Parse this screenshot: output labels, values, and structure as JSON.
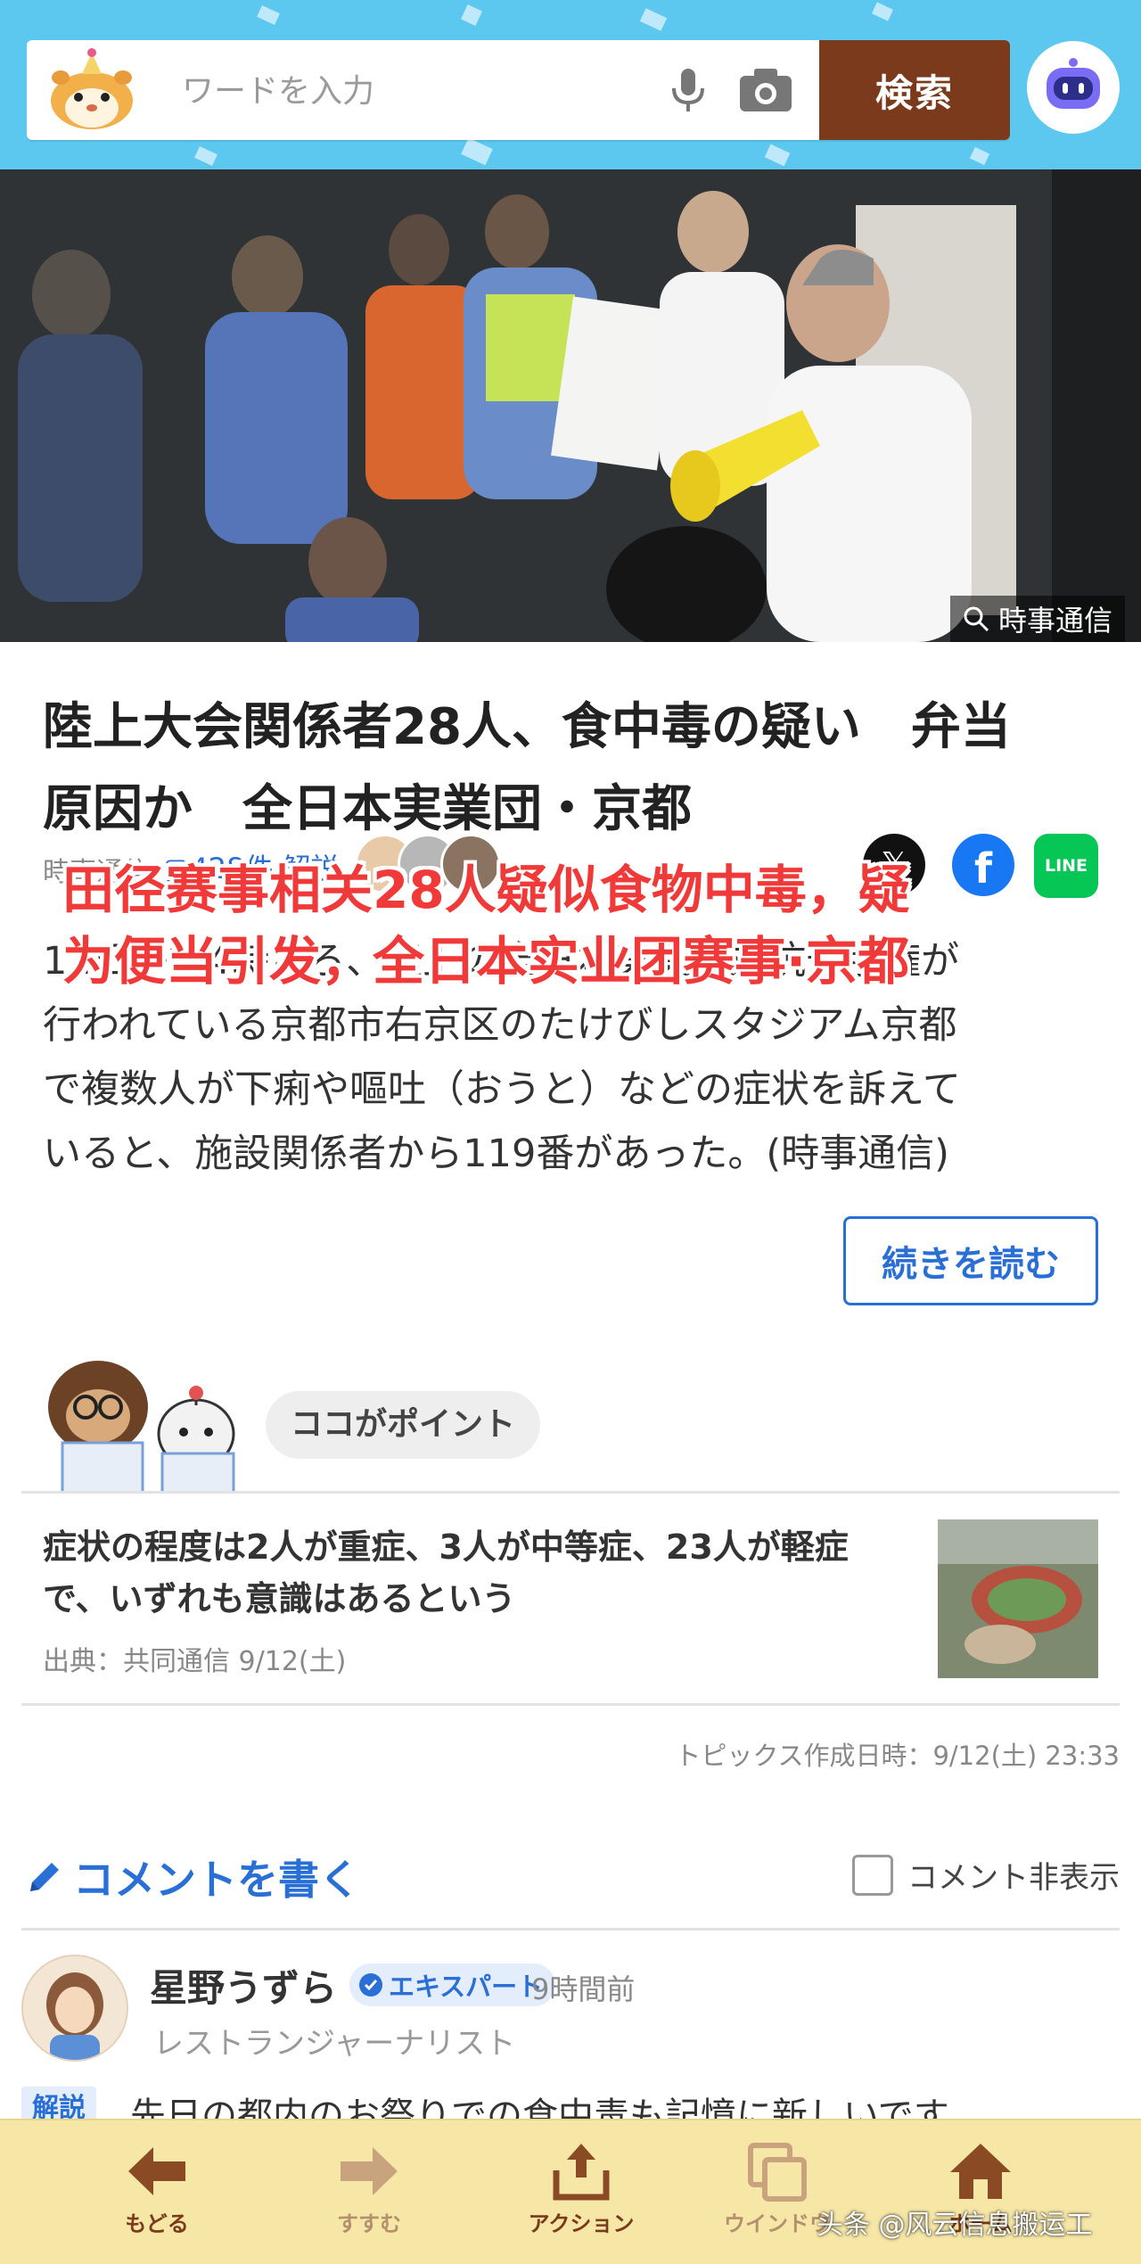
{
  "search": {
    "placeholder": "ワードを入力",
    "button_label": "検索"
  },
  "hero": {
    "credit": "時事通信"
  },
  "article": {
    "headline_line1": "陸上大会関係者28人、食中毒の疑い　弁当",
    "headline_line2": "原因か　全日本実業団・京都",
    "source": "時事通信",
    "comment_count": "428",
    "comment_label": "件 解説",
    "body_line1": "12日午後4時ごろ、陸上の全日本実業団対抗選手権が",
    "body_line2": "行われている京都市右京区のたけびしスタジアム京都",
    "body_line3": "で複数人が下痢や嘔吐（おうと）などの症状を訴えて",
    "body_line4": "いると、施設関係者から119番があった。(時事通信)",
    "read_more": "続きを読む",
    "share": {
      "x": "𝕏",
      "facebook": "f",
      "line": "LINE"
    }
  },
  "overlay_caption": {
    "line1": "田径赛事相关28人疑似食物中毒，疑",
    "line2": "为便当引发，全日本实业团赛事·京都"
  },
  "point": {
    "bubble": "ココがポイント",
    "text_line1": "症状の程度は2人が重症、3人が中等症、23人が軽症",
    "text_line2": "で、いずれも意識はあるという",
    "source": "出典：共同通信 9/12(土)",
    "topics_time": "トピックス作成日時：9/12(土) 23:33"
  },
  "comments": {
    "write_label": "コメントを書く",
    "hide_label": "コメント非表示",
    "first": {
      "name": "星野うずら",
      "badge": "エキスパート",
      "time": "9時間前",
      "title": "レストランジャーナリスト",
      "tag": "解説",
      "text": "先日の都内のお祭りでの食中毒も記憶に新しいです"
    }
  },
  "bottom_nav": {
    "back": "もどる",
    "forward": "すすむ",
    "action": "アクション",
    "window": "ウインドウ",
    "home": "ホーム"
  },
  "watermark": "头条 @风云信息搬运工",
  "colors": {
    "header_bg": "#5cc8f0",
    "search_button": "#7a3a1b",
    "link_blue": "#2a6fd6",
    "overlay_red": "#f03a3a",
    "bottom_bar": "#f7e7a6"
  }
}
